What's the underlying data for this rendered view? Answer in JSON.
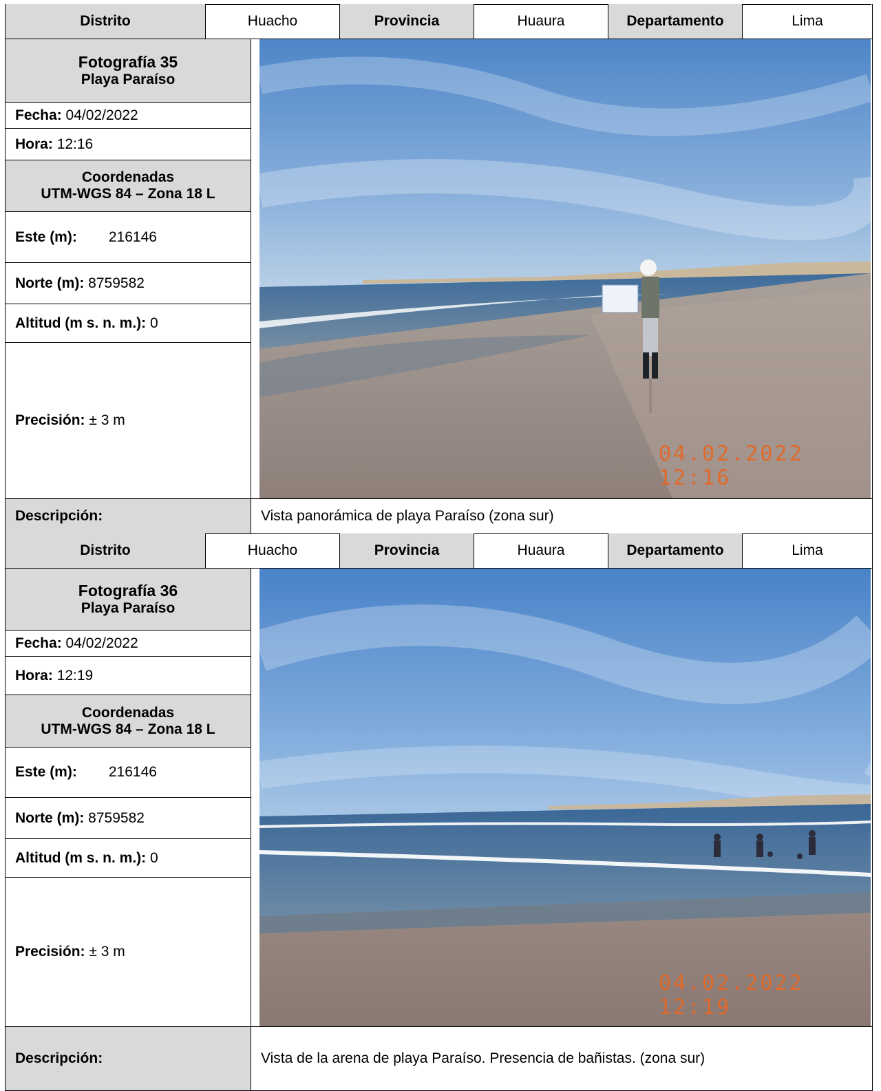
{
  "records": [
    {
      "header": {
        "distrito_label": "Distrito",
        "distrito_value": "Huacho",
        "provincia_label": "Provincia",
        "provincia_value": "Huaura",
        "departamento_label": "Departamento",
        "departamento_value": "Lima"
      },
      "photo_title": "Fotografía 35",
      "photo_subtitle": "Playa Paraíso",
      "fecha_label": "Fecha:",
      "fecha_value": "04/02/2022",
      "hora_label": "Hora:",
      "hora_value": "12:16",
      "coord_title": "Coordenadas",
      "coord_system": "UTM-WGS 84 – Zona 18 L",
      "este_label": "Este (m):",
      "este_value": "216146",
      "norte_label": "Norte (m):",
      "norte_value": "8759582",
      "altitud_label": "Altitud (m s. n. m.):",
      "altitud_value": "0",
      "precision_label": "Precisión:",
      "precision_value": "± 3 m",
      "photo_stamp": "04.02.2022 12:16",
      "descripcion_label": "Descripción:",
      "descripcion_value": "Vista panorámica de playa Paraíso (zona sur)"
    },
    {
      "header": {
        "distrito_label": "Distrito",
        "distrito_value": "Huacho",
        "provincia_label": "Provincia",
        "provincia_value": "Huaura",
        "departamento_label": "Departamento",
        "departamento_value": "Lima"
      },
      "photo_title": "Fotografía 36",
      "photo_subtitle": "Playa Paraíso",
      "fecha_label": "Fecha:",
      "fecha_value": "04/02/2022",
      "hora_label": "Hora:",
      "hora_value": "12:19",
      "coord_title": "Coordenadas",
      "coord_system": "UTM-WGS 84 – Zona 18 L",
      "este_label": "Este (m):",
      "este_value": "216146",
      "norte_label": "Norte (m):",
      "norte_value": "8759582",
      "altitud_label": "Altitud (m s. n. m.):",
      "altitud_value": "0",
      "precision_label": "Precisión:",
      "precision_value": "± 3 m",
      "photo_stamp": "04.02.2022 12:19",
      "descripcion_label": "Descripción:",
      "descripcion_value": "Vista de la arena de playa Paraíso. Presencia de bañistas. (zona sur)"
    }
  ],
  "colors": {
    "label_bg": "#d9d9d9",
    "stamp": "#e06a2a"
  }
}
